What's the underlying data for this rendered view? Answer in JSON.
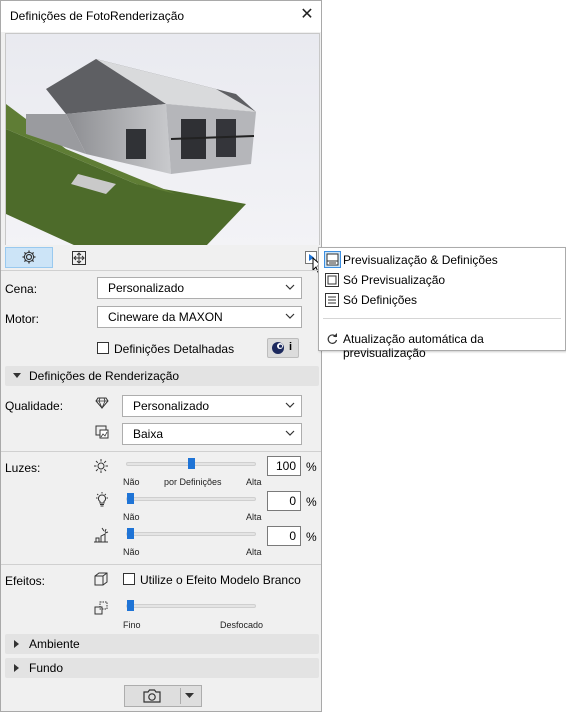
{
  "window": {
    "title": "Definições de FotoRenderização"
  },
  "scene": {
    "label": "Cena:",
    "value": "Personalizado"
  },
  "engine": {
    "label": "Motor:",
    "value": "Cineware da MAXON",
    "info_label": "i"
  },
  "detailed": {
    "label": "Definições Detalhadas",
    "checked": false
  },
  "render_section": {
    "label": "Definições de Renderização"
  },
  "quality": {
    "label": "Qualidade:",
    "value1": "Personalizado",
    "value2": "Baixa"
  },
  "lights": {
    "label": "Luzes:",
    "slider1": {
      "value": "100",
      "unit": "%",
      "min": "Não",
      "mid": "por Definições",
      "max": "Alta",
      "level": 0.5
    },
    "slider2": {
      "value": "0",
      "unit": "%",
      "min": "Não",
      "max": "Alta",
      "level": 0
    },
    "slider3": {
      "value": "0",
      "unit": "%",
      "min": "Não",
      "max": "Alta",
      "level": 0
    }
  },
  "effects": {
    "label": "Efeitos:",
    "white_model": {
      "label": "Utilize o Efeito Modelo Branco",
      "checked": false
    },
    "blur": {
      "min": "Fino",
      "max": "Desfocado",
      "level": 0
    }
  },
  "environment_section": {
    "label": "Ambiente"
  },
  "background_section": {
    "label": "Fundo"
  },
  "menu": {
    "items": [
      {
        "label": "Previsualização & Definições",
        "icon": "preview-and-settings-icon",
        "selected": true
      },
      {
        "label": "Só Previsualização",
        "icon": "preview-only-icon",
        "selected": false
      },
      {
        "label": "Só Definições",
        "icon": "settings-only-icon",
        "selected": false
      }
    ],
    "auto_update": {
      "label": "Atualização automática da previsualização",
      "icon": "refresh-icon"
    }
  },
  "colors": {
    "accent": "#1f74d6",
    "active_tab": "#cce4f7",
    "section_bg": "#e3e3e3"
  }
}
